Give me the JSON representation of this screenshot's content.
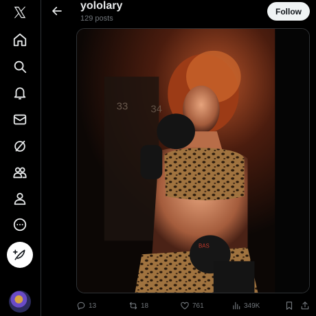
{
  "sidebar": {
    "items": [
      {
        "icon": "x-logo-icon"
      },
      {
        "icon": "home-icon"
      },
      {
        "icon": "search-icon"
      },
      {
        "icon": "bell-icon"
      },
      {
        "icon": "mail-icon"
      },
      {
        "icon": "grok-icon"
      },
      {
        "icon": "communities-icon"
      },
      {
        "icon": "profile-icon"
      },
      {
        "icon": "more-icon"
      }
    ],
    "post_icon": "feather-plus-icon"
  },
  "header": {
    "title": "yololary",
    "posts_count": "129 posts",
    "follow_label": "Follow"
  },
  "actions": {
    "replies": "13",
    "reposts": "18",
    "likes": "761",
    "views": "349K"
  },
  "colors": {
    "background": "#000000",
    "muted_text": "#71767b",
    "primary_text": "#e7e9ea",
    "follow_bg": "#eff3f4"
  }
}
